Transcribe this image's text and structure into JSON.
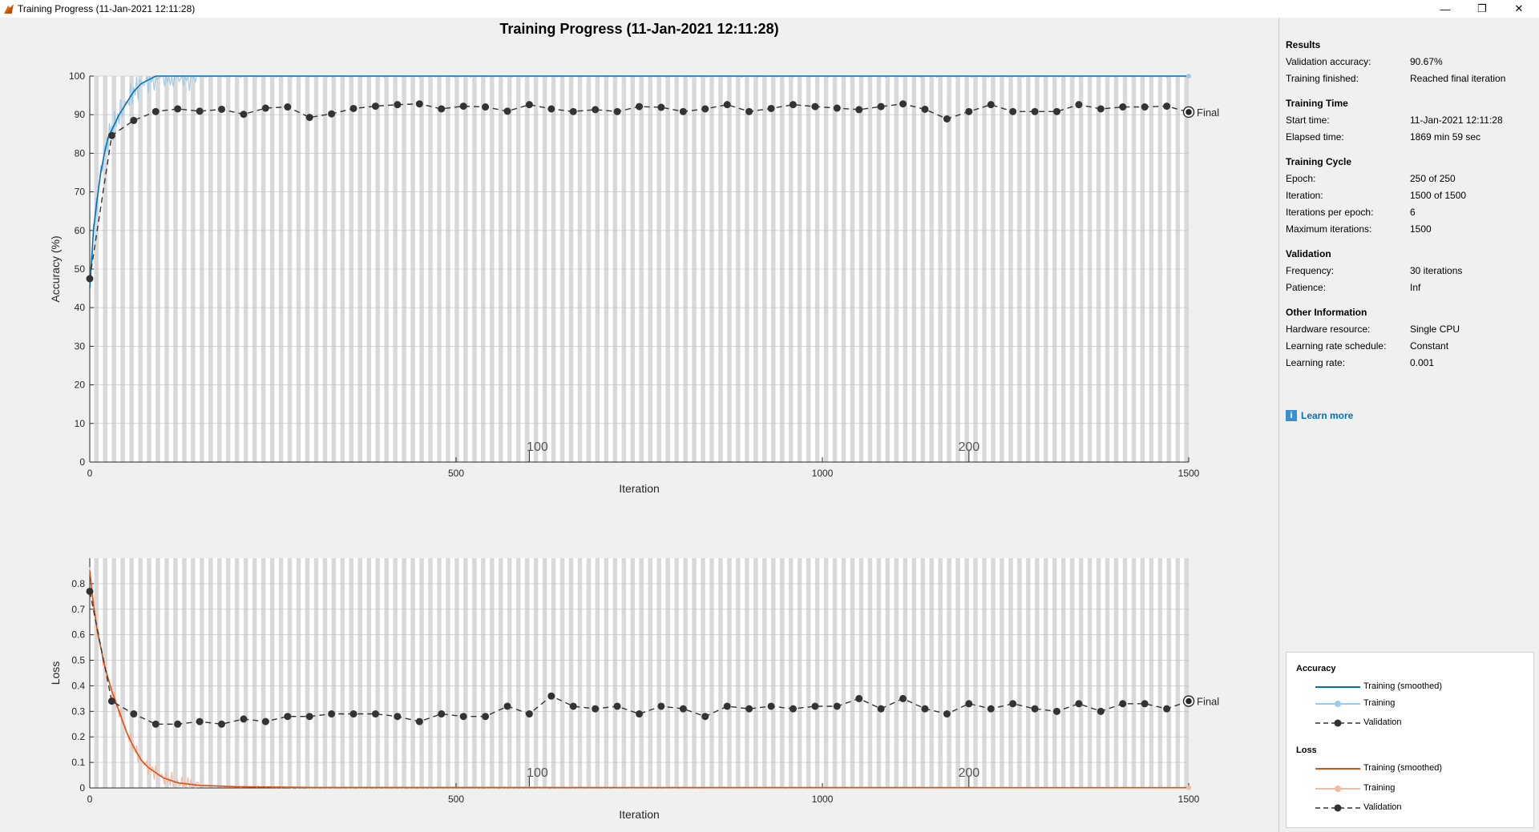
{
  "window": {
    "title": "Training Progress (11-Jan-2021 12:11:28)"
  },
  "figure": {
    "title": "Training Progress (11-Jan-2021 12:11:28)"
  },
  "colors": {
    "training_acc": "#0072bd",
    "training_acc_raw": "#9ecae9",
    "training_loss": "#d95319",
    "training_loss_raw": "#f4b9a1",
    "validation": "#333333",
    "epoch_band": "#d9d9d9"
  },
  "icons": {
    "app": "matlab-icon",
    "minimize": "minimize-icon",
    "maximize": "restore-icon",
    "close": "close-icon",
    "info": "info-icon"
  },
  "chart_data": [
    {
      "type": "line",
      "name": "accuracy",
      "xlabel": "Iteration",
      "ylabel": "Accuracy (%)",
      "xlim": [
        0,
        1500
      ],
      "ylim": [
        0,
        100
      ],
      "xticks": [
        0,
        500,
        1000,
        1500
      ],
      "yticks": [
        0,
        10,
        20,
        30,
        40,
        50,
        60,
        70,
        80,
        90,
        100
      ],
      "epoch_labels": [
        {
          "epoch": "100",
          "iteration": 600
        },
        {
          "epoch": "200",
          "iteration": 1200
        }
      ],
      "final_label": "Final",
      "series": [
        {
          "name": "Training (smoothed)",
          "x": [
            0,
            5,
            10,
            15,
            20,
            25,
            30,
            40,
            50,
            60,
            70,
            80,
            90,
            100,
            1500
          ],
          "values": [
            45,
            60,
            68,
            75,
            80,
            84,
            86,
            90,
            93,
            96,
            98,
            99,
            100,
            100,
            100
          ]
        },
        {
          "name": "Validation",
          "x": [
            0,
            30,
            60,
            90,
            120,
            150,
            180,
            210,
            240,
            270,
            300,
            330,
            360,
            390,
            420,
            450,
            480,
            510,
            540,
            570,
            600,
            630,
            660,
            690,
            720,
            750,
            780,
            810,
            840,
            870,
            900,
            930,
            960,
            990,
            1020,
            1050,
            1080,
            1110,
            1140,
            1170,
            1200,
            1230,
            1260,
            1290,
            1320,
            1350,
            1380,
            1410,
            1440,
            1470,
            1500
          ],
          "values": [
            47.5,
            84.6,
            88.5,
            90.8,
            91.5,
            90.9,
            91.4,
            90.1,
            91.7,
            92.0,
            89.3,
            90.2,
            91.6,
            92.2,
            92.6,
            92.8,
            91.5,
            92.2,
            92.0,
            90.9,
            92.6,
            91.5,
            90.8,
            91.3,
            90.8,
            92.1,
            91.9,
            90.8,
            91.5,
            92.6,
            90.8,
            91.6,
            92.6,
            92.1,
            91.7,
            91.3,
            92.1,
            92.8,
            91.4,
            88.9,
            90.8,
            92.6,
            90.8,
            90.8,
            90.8,
            92.6,
            91.5,
            92.0,
            92.0,
            92.2,
            90.67
          ]
        }
      ]
    },
    {
      "type": "line",
      "name": "loss",
      "xlabel": "Iteration",
      "ylabel": "Loss",
      "xlim": [
        0,
        1500
      ],
      "ylim": [
        0,
        0.9
      ],
      "xticks": [
        0,
        500,
        1000,
        1500
      ],
      "yticks": [
        0,
        0.1,
        0.2,
        0.3,
        0.4,
        0.5,
        0.6,
        0.7,
        0.8
      ],
      "epoch_labels": [
        {
          "epoch": "100",
          "iteration": 600
        },
        {
          "epoch": "200",
          "iteration": 1200
        }
      ],
      "final_label": "Final",
      "series": [
        {
          "name": "Training (smoothed)",
          "x": [
            0,
            5,
            10,
            20,
            30,
            40,
            50,
            60,
            70,
            80,
            90,
            100,
            120,
            150,
            200,
            300,
            1500
          ],
          "values": [
            0.85,
            0.72,
            0.62,
            0.48,
            0.38,
            0.3,
            0.22,
            0.16,
            0.11,
            0.08,
            0.06,
            0.04,
            0.02,
            0.01,
            0.005,
            0.002,
            0.001
          ]
        },
        {
          "name": "Validation",
          "x": [
            0,
            30,
            60,
            90,
            120,
            150,
            180,
            210,
            240,
            270,
            300,
            330,
            360,
            390,
            420,
            450,
            480,
            510,
            540,
            570,
            600,
            630,
            660,
            690,
            720,
            750,
            780,
            810,
            840,
            870,
            900,
            930,
            960,
            990,
            1020,
            1050,
            1080,
            1110,
            1140,
            1170,
            1200,
            1230,
            1260,
            1290,
            1320,
            1350,
            1380,
            1410,
            1440,
            1470,
            1500
          ],
          "values": [
            0.77,
            0.34,
            0.29,
            0.25,
            0.25,
            0.26,
            0.25,
            0.27,
            0.26,
            0.28,
            0.28,
            0.29,
            0.29,
            0.29,
            0.28,
            0.26,
            0.29,
            0.28,
            0.28,
            0.32,
            0.29,
            0.36,
            0.32,
            0.31,
            0.32,
            0.29,
            0.32,
            0.31,
            0.28,
            0.32,
            0.31,
            0.32,
            0.31,
            0.32,
            0.32,
            0.35,
            0.31,
            0.35,
            0.31,
            0.29,
            0.33,
            0.31,
            0.33,
            0.31,
            0.3,
            0.33,
            0.3,
            0.33,
            0.33,
            0.31,
            0.34
          ]
        }
      ]
    }
  ],
  "results": {
    "heading": "Results",
    "rows": [
      {
        "label": "Validation accuracy:",
        "value": "90.67%"
      },
      {
        "label": "Training finished:",
        "value": "Reached final iteration"
      }
    ]
  },
  "training_time": {
    "heading": "Training Time",
    "rows": [
      {
        "label": "Start time:",
        "value": "11-Jan-2021 12:11:28"
      },
      {
        "label": "Elapsed time:",
        "value": "1869 min 59 sec"
      }
    ]
  },
  "training_cycle": {
    "heading": "Training Cycle",
    "rows": [
      {
        "label": "Epoch:",
        "value": "250 of 250"
      },
      {
        "label": "Iteration:",
        "value": "1500 of 1500"
      },
      {
        "label": "Iterations per epoch:",
        "value": "6"
      },
      {
        "label": "Maximum iterations:",
        "value": "1500"
      }
    ]
  },
  "validation": {
    "heading": "Validation",
    "rows": [
      {
        "label": "Frequency:",
        "value": "30 iterations"
      },
      {
        "label": "Patience:",
        "value": "Inf"
      }
    ]
  },
  "other_info": {
    "heading": "Other Information",
    "rows": [
      {
        "label": "Hardware resource:",
        "value": "Single CPU"
      },
      {
        "label": "Learning rate schedule:",
        "value": "Constant"
      },
      {
        "label": "Learning rate:",
        "value": "0.001"
      }
    ]
  },
  "learn_more": {
    "label": "Learn more"
  },
  "legend": {
    "accuracy_heading": "Accuracy",
    "loss_heading": "Loss",
    "smoothed": "Training (smoothed)",
    "training": "Training",
    "validation": "Validation"
  }
}
